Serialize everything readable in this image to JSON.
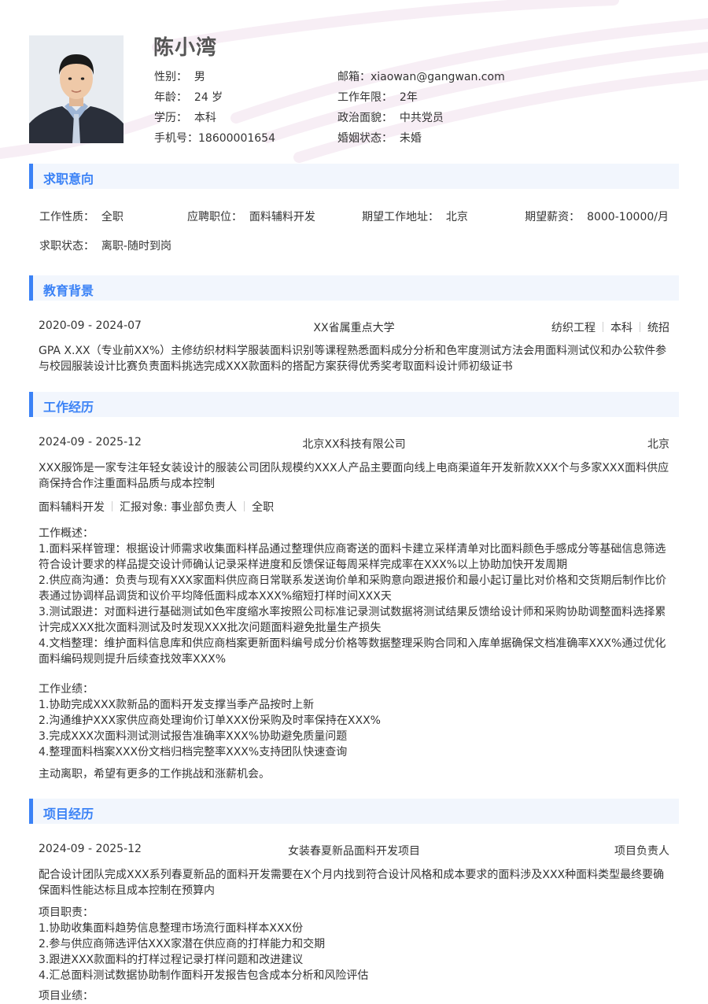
{
  "profile": {
    "name": "陈小湾",
    "fields": {
      "gender_label": "性别：",
      "gender": "男",
      "age_label": "年龄：",
      "age": "24 岁",
      "education_label": "学历：",
      "education": "本科",
      "phone_label": "手机号：",
      "phone": "18600001654",
      "email_label": "邮箱：",
      "email": "xiaowan@gangwan.com",
      "years_label": "工作年限：",
      "years": "2年",
      "politics_label": "政治面貌：",
      "politics": "中共党员",
      "marital_label": "婚姻状态：",
      "marital": "未婚"
    }
  },
  "intention": {
    "title": "求职意向",
    "type_label": "工作性质：",
    "type": "全职",
    "position_label": "应聘职位：",
    "position": "面料辅料开发",
    "city_label": "期望工作地址：",
    "city": "北京",
    "salary_label": "期望薪资：",
    "salary": "8000-10000/月",
    "status_label": "求职状态：",
    "status": "离职-随时到岗"
  },
  "education": {
    "title": "教育背景",
    "period": "2020-09 - 2024-07",
    "school": "XX省属重点大学",
    "major": "纺织工程",
    "degree": "本科",
    "mode": "统招",
    "description": "GPA X.XX（专业前XX%）主修纺织材料学服装面料识别等课程熟悉面料成分分析和色牢度测试方法会用面料测试仪和办公软件参与校园服装设计比赛负责面料挑选完成XXX款面料的搭配方案获得优秀奖考取面料设计师初级证书"
  },
  "work": {
    "title": "工作经历",
    "period": "2024-09 - 2025-12",
    "company": "北京XX科技有限公司",
    "city": "北京",
    "company_desc": "XXX服饰是一家专注年轻女装设计的服装公司团队规模约XXX人产品主要面向线上电商渠道年开发新款XXX个与多家XXX面料供应商保持合作注重面料品质与成本控制",
    "tag_role": "面料辅料开发",
    "tag_report": "汇报对象: 事业部负责人",
    "tag_type": "全职",
    "overview_label": "工作概述：",
    "duties": [
      "1.面料采样管理：根据设计师需求收集面料样品通过整理供应商寄送的面料卡建立采样清单对比面料颜色手感成分等基础信息筛选符合设计要求的样品提交设计师确认记录采样进度和反馈保证每周采样完成率在XXX%以上协助加快开发周期",
      "2.供应商沟通：负责与现有XXX家面料供应商日常联系发送询价单和采购意向跟进报价和最小起订量比对价格和交货期后制作比价表通过协调样品调货和议价平均降低面料成本XXX%缩短打样时间XXX天",
      "3.测试跟进：对面料进行基础测试如色牢度缩水率按照公司标准记录测试数据将测试结果反馈给设计师和采购协助调整面料选择累计完成XXX批次面料测试及时发现XXX批次问题面料避免批量生产损失",
      "4.文档整理：维护面料信息库和供应商档案更新面料编号成分价格等数据整理采购合同和入库单据确保文档准确率XXX%通过优化面料编码规则提升后续查找效率XXX%"
    ],
    "achievements_label": "工作业绩：",
    "achievements": [
      "1.协助完成XXX款新品的面料开发支撑当季产品按时上新",
      "2.沟通维护XXX家供应商处理询价订单XXX份采购及时率保持在XXX%",
      "3.完成XXX次面料测试测试报告准确率XXX%协助避免质量问题",
      "4.整理面料档案XXX份文档归档完整率XXX%支持团队快速查询"
    ],
    "leave_reason": "主动离职，希望有更多的工作挑战和涨薪机会。"
  },
  "project": {
    "title": "项目经历",
    "period": "2024-09 - 2025-12",
    "name": "女装春夏新品面料开发项目",
    "role": "项目负责人",
    "description": "配合设计团队完成XXX系列春夏新品的面料开发需要在X个月内找到符合设计风格和成本要求的面料涉及XXX种面料类型最终要确保面料性能达标且成本控制在预算内",
    "duty_label": "项目职责：",
    "duties": [
      "1.协助收集面料趋势信息整理市场流行面料样本XXX份",
      "2.参与供应商筛选评估XXX家潜在供应商的打样能力和交期",
      "3.跟进XXX款面料的打样过程记录打样问题和改进建议",
      "4.汇总面料测试数据协助制作面料开发报告包含成本分析和风险评估"
    ],
    "achievement_label": "项目业绩："
  }
}
